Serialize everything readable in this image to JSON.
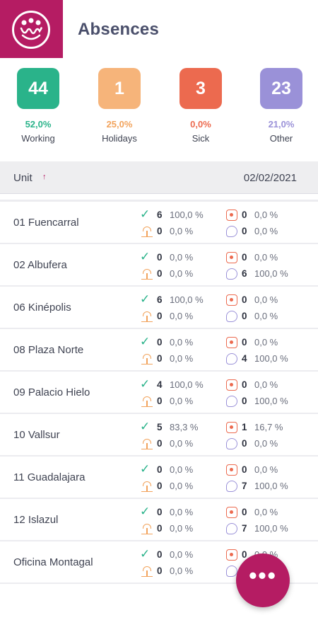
{
  "header": {
    "title": "Absences"
  },
  "stats": [
    {
      "key": "working",
      "value": "44",
      "pct": "52,0%",
      "label": "Working",
      "color": "#2ab38a"
    },
    {
      "key": "holidays",
      "value": "1",
      "pct": "25,0%",
      "label": "Holidays",
      "color": "#f6b47a"
    },
    {
      "key": "sick",
      "value": "3",
      "pct": "0,0%",
      "label": "Sick",
      "color": "#ec6a4f"
    },
    {
      "key": "other",
      "value": "23",
      "pct": "21,0%",
      "label": "Other",
      "color": "#9a91d8"
    }
  ],
  "table": {
    "unit_label": "Unit",
    "sort_indicator": "↑",
    "date": "02/02/2021",
    "rows": [
      {
        "name": "01 Fuencarral",
        "working": [
          "6",
          "100,0 %"
        ],
        "sick": [
          "0",
          "0,0 %"
        ],
        "holidays": [
          "0",
          "0,0 %"
        ],
        "other": [
          "0",
          "0,0 %"
        ]
      },
      {
        "name": "02 Albufera",
        "working": [
          "0",
          "0,0 %"
        ],
        "sick": [
          "0",
          "0,0 %"
        ],
        "holidays": [
          "0",
          "0,0 %"
        ],
        "other": [
          "6",
          "100,0 %"
        ]
      },
      {
        "name": "06 Kinépolis",
        "working": [
          "6",
          "100,0 %"
        ],
        "sick": [
          "0",
          "0,0 %"
        ],
        "holidays": [
          "0",
          "0,0 %"
        ],
        "other": [
          "0",
          "0,0 %"
        ]
      },
      {
        "name": "08 Plaza Norte",
        "working": [
          "0",
          "0,0 %"
        ],
        "sick": [
          "0",
          "0,0 %"
        ],
        "holidays": [
          "0",
          "0,0 %"
        ],
        "other": [
          "4",
          "100,0 %"
        ]
      },
      {
        "name": "09 Palacio Hielo",
        "working": [
          "4",
          "100,0 %"
        ],
        "sick": [
          "0",
          "0,0 %"
        ],
        "holidays": [
          "0",
          "0,0 %"
        ],
        "other": [
          "0",
          "100,0 %"
        ]
      },
      {
        "name": "10 Vallsur",
        "working": [
          "5",
          "83,3 %"
        ],
        "sick": [
          "1",
          "16,7 %"
        ],
        "holidays": [
          "0",
          "0,0 %"
        ],
        "other": [
          "0",
          "0,0 %"
        ]
      },
      {
        "name": "11 Guadalajara",
        "working": [
          "0",
          "0,0 %"
        ],
        "sick": [
          "0",
          "0,0 %"
        ],
        "holidays": [
          "0",
          "0,0 %"
        ],
        "other": [
          "7",
          "100,0 %"
        ]
      },
      {
        "name": "12 Islazul",
        "working": [
          "0",
          "0,0 %"
        ],
        "sick": [
          "0",
          "0,0 %"
        ],
        "holidays": [
          "0",
          "0,0 %"
        ],
        "other": [
          "7",
          "100,0 %"
        ]
      },
      {
        "name": "Oficina Montagal",
        "working": [
          "0",
          "0,0 %"
        ],
        "sick": [
          "0",
          "0,0 %"
        ],
        "holidays": [
          "0",
          "0,0 %"
        ],
        "other": [
          "0",
          "0,0 %"
        ]
      }
    ]
  },
  "fab": {
    "label": "•••",
    "icon": "more-icon"
  },
  "icons": {
    "working": "check-icon",
    "sick": "sick-icon",
    "holidays": "holidays-icon",
    "other": "other-icon"
  }
}
